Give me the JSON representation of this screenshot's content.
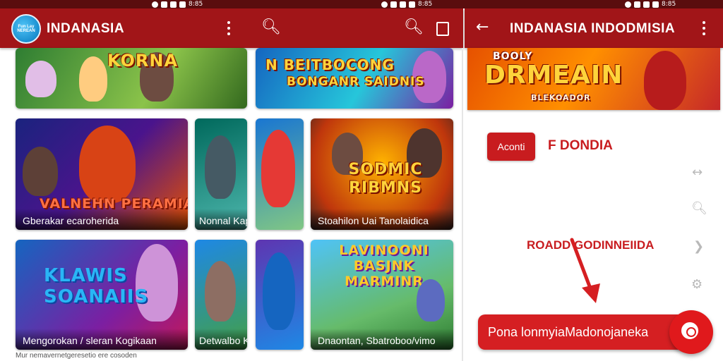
{
  "status_bar": {
    "clock": "8:85"
  },
  "left_panel": {
    "app_title": "INDANASIA",
    "logo_text": "Fun Lay NEREAN",
    "cards": [
      {
        "title": "KORNA",
        "caption": ""
      },
      {
        "title": "VALNEHN PERAMIAN",
        "caption": "Gberakar ecaroherida"
      },
      {
        "title": "",
        "caption": "Nonnal Kap Rugi"
      },
      {
        "title": "KLAWIS SOANAIIS",
        "caption": "Mengorokan / sleran Kogikaan"
      },
      {
        "title": "",
        "caption": "Detwalbo Kan Kao"
      }
    ],
    "footer_text": "Mur nemavernetgeresetio ere cosoden"
  },
  "middle_panel": {
    "banner_title_1": "N BEITBOCONG",
    "banner_title_2": "BONGANR SAIDNIS",
    "cards": [
      {
        "title": "SODMIC RIBMNS",
        "caption": "Stoahilon Uai Tanolaidica"
      },
      {
        "title": "LAVINOONI BASJNK MARMINR",
        "caption": "Dnaontan, Sbatroboo/vimo"
      }
    ]
  },
  "right_panel": {
    "app_title": "INDANASIA INDODMISIA",
    "banner_small": "BOOLY",
    "banner_title": "DRMEAIN",
    "banner_sub": "BLEKOADOR",
    "chip_label": "Aconti",
    "heading": "F DONDIA",
    "label_2": "ROADD  GODINNEIIDA",
    "cta_label": "Pona lonmyiaMadonojaneka"
  },
  "colors": {
    "appbar": "#a11518",
    "accent": "#d51f22",
    "statusbar": "#5a0d0e"
  }
}
